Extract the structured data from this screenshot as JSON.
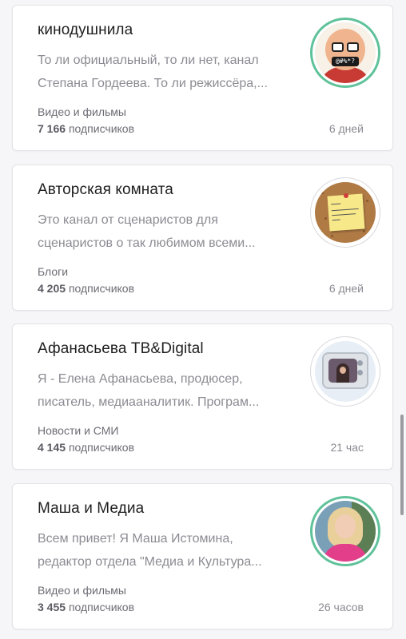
{
  "cards": [
    {
      "title": "кинодушнила",
      "desc_line1": "То ли официальный, то ли нет, канал",
      "desc_line2": "Степана Гордеева. То ли режиссёра,...",
      "category": "Видео и фильмы",
      "subs_count": "7 166",
      "subs_label": "подписчиков",
      "time": "6 дней",
      "avatar_icon": "cartoon-face-avatar",
      "avatar_mouth": "@#%*?",
      "ring_color": "#5fc29a"
    },
    {
      "title": "Авторская комната",
      "desc_line1": "Это канал от сценаристов для",
      "desc_line2": "сценаристов о так любимом всеми...",
      "category": "Блоги",
      "subs_count": "4 205",
      "subs_label": "подписчиков",
      "time": "6 дней",
      "avatar_icon": "sticky-note-avatar"
    },
    {
      "title": "Афанасьева ТВ&Digital",
      "desc_line1": "Я - Елена Афанасьева, продюсер,",
      "desc_line2": "писатель, медиааналитик. Програм...",
      "category": "Новости и СМИ",
      "subs_count": "4 145",
      "subs_label": "подписчиков",
      "time": "21 час",
      "avatar_icon": "retro-tv-avatar"
    },
    {
      "title": "Маша и Медиа",
      "desc_line1": "Всем привет! Я Маша Истомина,",
      "desc_line2": "редактор отдела \"Медиа и Культура...",
      "category": "Видео и фильмы",
      "subs_count": "3 455",
      "subs_label": "подписчиков",
      "time": "26 часов",
      "avatar_icon": "portrait-photo-avatar",
      "ring_color": "#5fc29a"
    }
  ]
}
